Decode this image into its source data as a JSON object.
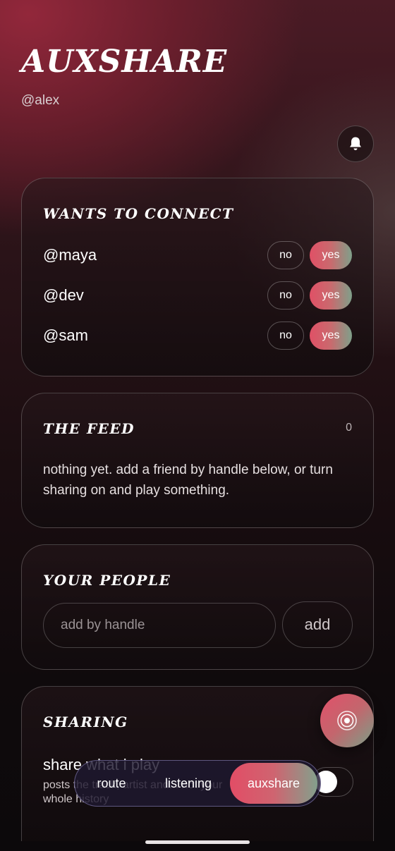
{
  "header": {
    "brand": "AUXSHARE",
    "handle": "@alex",
    "bell_icon": "bell-icon"
  },
  "connect": {
    "title": "wants to connect",
    "requests": [
      {
        "handle": "@maya",
        "no": "no",
        "yes": "yes"
      },
      {
        "handle": "@dev",
        "no": "no",
        "yes": "yes"
      },
      {
        "handle": "@sam",
        "no": "no",
        "yes": "yes"
      }
    ]
  },
  "feed": {
    "title": "the feed",
    "count": "0",
    "empty_text": "nothing yet. add a friend by handle below, or turn sharing on and play something."
  },
  "people": {
    "title": "your people",
    "input_placeholder": "add by handle",
    "add_label": "add"
  },
  "sharing": {
    "title": "sharing",
    "share_label": "share what i play",
    "share_sub": "posts the track, artist and... not your whole history",
    "toggle_on": false
  },
  "fab": {
    "icon": "broadcast-icon"
  },
  "nav": {
    "items": [
      "route",
      "listening",
      "auxshare"
    ],
    "active": "auxshare"
  },
  "colors": {
    "accent_start": "#e24d66",
    "accent_end": "#83a08c",
    "background": "#0f0a0c"
  }
}
